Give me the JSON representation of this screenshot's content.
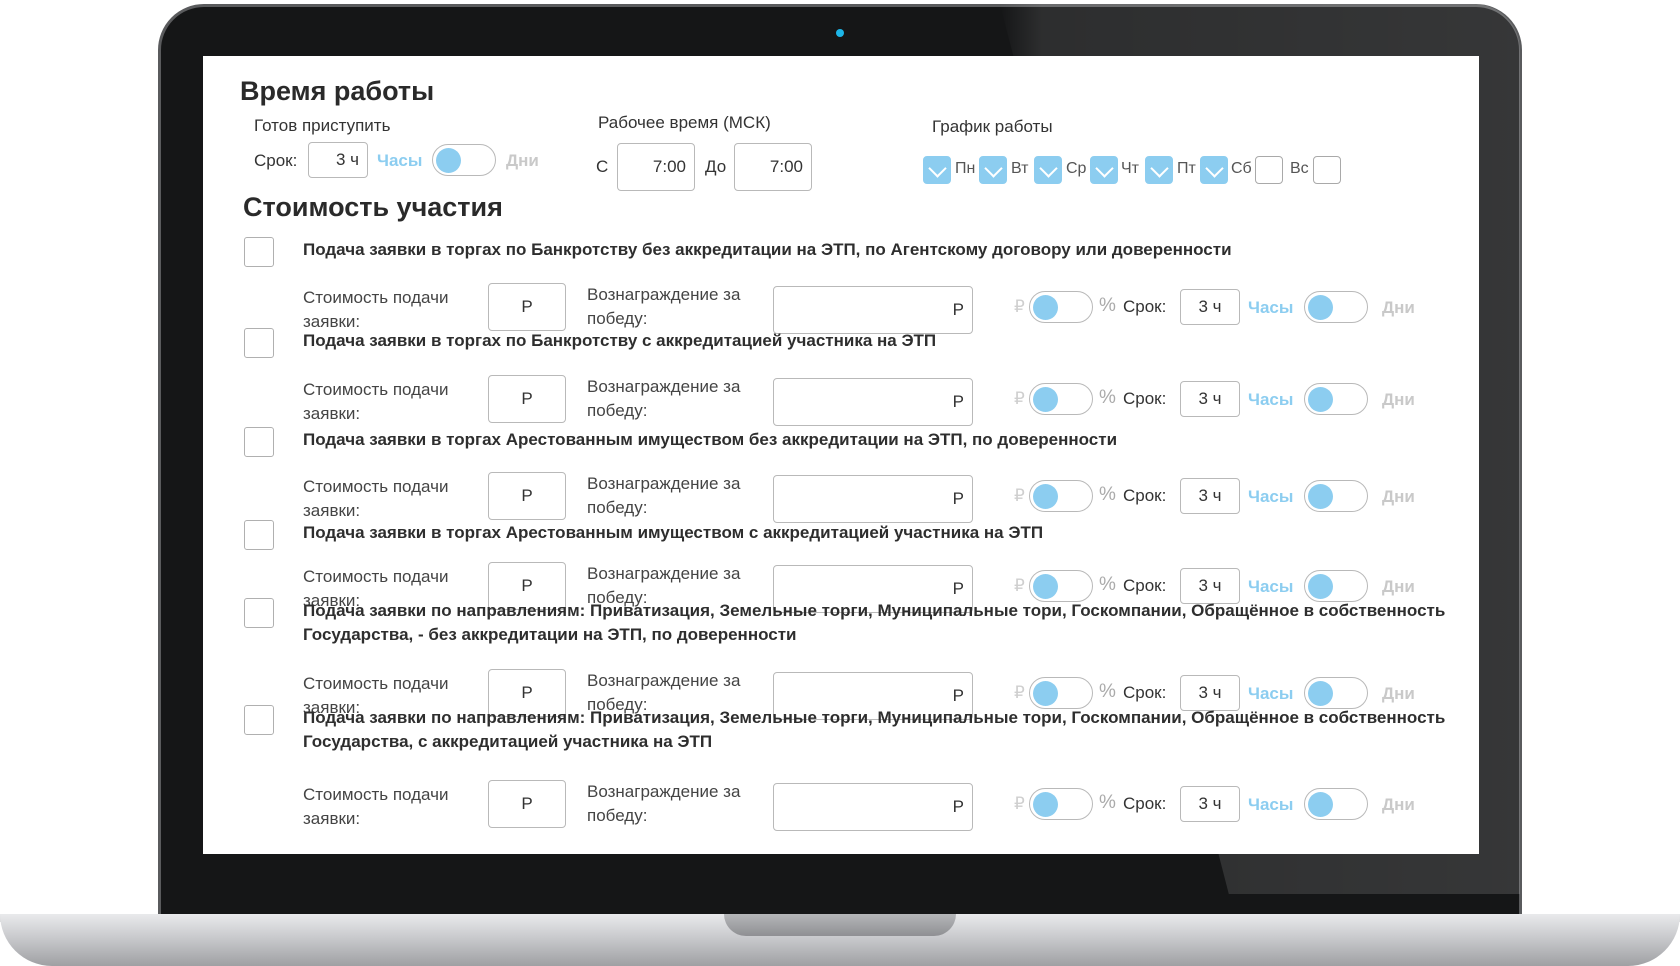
{
  "work_time": {
    "title": "Время работы",
    "ready_label": "Готов приступить",
    "term_label": "Срок:",
    "term_value": "3 ч",
    "unit_hours": "Часы",
    "unit_days": "Дни",
    "hours_label": "Рабочее время (МСК)",
    "from_label": "С",
    "from_value": "7:00",
    "to_label": "До",
    "to_value": "7:00",
    "schedule_label": "График работы",
    "days": [
      {
        "label": "Пн",
        "checked": true
      },
      {
        "label": "Вт",
        "checked": true
      },
      {
        "label": "Ср",
        "checked": true
      },
      {
        "label": "Чт",
        "checked": true
      },
      {
        "label": "Пт",
        "checked": true
      },
      {
        "label": "Сб",
        "checked": true
      },
      {
        "label": "Вс",
        "checked": false
      }
    ]
  },
  "cost": {
    "title": "Стоимость участия",
    "fee_label": "Стоимость подачи заявки:",
    "reward_label": "Вознаграждение за победу:",
    "currency": "Р",
    "rub_sign": "₽",
    "percent_sign": "%",
    "term_label": "Срок:",
    "term_value": "3 ч",
    "unit_hours": "Часы",
    "unit_days": "Дни",
    "services": [
      {
        "title": "Подача заявки в торгах по Банкротству без аккредитации на ЭТП, по Агентскому договору или доверенности"
      },
      {
        "title": "Подача заявки в торгах по Банкротству с аккредитацией участника на ЭТП"
      },
      {
        "title": "Подача заявки в торгах Арестованным имуществом без аккредитации на ЭТП, по доверенности"
      },
      {
        "title": "Подача заявки в торгах Арестованным имуществом с аккредитацией участника на ЭТП"
      },
      {
        "title": "Подача заявки по направлениям: Приватизация, Земельные торги, Муниципальные тори, Госкомпании, Обращённое в собственность Государства, - без аккредитации на ЭТП, по доверенности"
      },
      {
        "title": "Подача заявки по направлениям: Приватизация, Земельные торги, Муниципальные тори, Госкомпании, Обращённое в собственность Государства, с аккредитацией участника на ЭТП"
      }
    ]
  },
  "colors": {
    "accent": "#8ccdf0",
    "disabled_text": "#c9c9c9",
    "bezel": "#151617"
  }
}
